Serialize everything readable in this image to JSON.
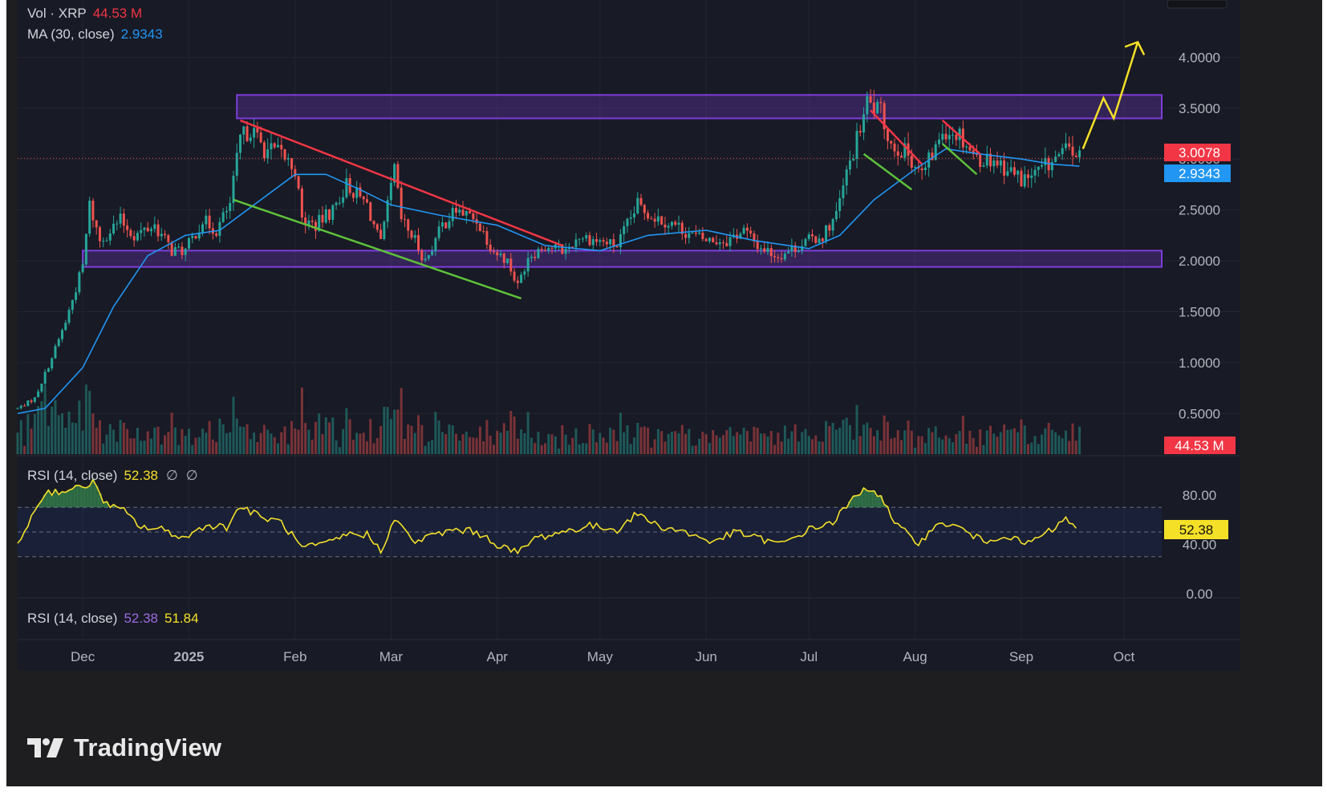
{
  "legend": {
    "vol_label": "Vol · XRP",
    "vol_value": "44.53 M",
    "ma_label": "MA (30, close)",
    "ma_value": "2.9343",
    "rsi_label": "RSI (14, close)",
    "rsi_value": "52.38",
    "rsi_na_1": "∅",
    "rsi_na_2": "∅",
    "rsi2_label": "RSI (14, close)",
    "rsi2_value_a": "52.38",
    "rsi2_value_b": "51.84"
  },
  "badges": {
    "price": "3.0078",
    "ma": "2.9343",
    "volume": "44.53 M",
    "rsi": "52.38"
  },
  "colors": {
    "background": "#1e1e20",
    "pane": "#181a25",
    "up": "#26a69a",
    "down": "#ef5350",
    "ma": "#2196f3",
    "rsi": "#f5e028",
    "zone": "#7e3ddb",
    "resistance_line": "#f23645",
    "support_line": "#5ec23a",
    "arrow": "#f5e028",
    "text": "#b2b5be"
  },
  "brand": {
    "name": "TradingView"
  },
  "chart_data": {
    "type": "candlestick",
    "symbol": "XRP",
    "x_axis": {
      "labels": [
        "Dec",
        "2025",
        "Feb",
        "Mar",
        "Apr",
        "May",
        "Jun",
        "Jul",
        "Aug",
        "Sep",
        "Oct"
      ],
      "dates": [
        "2024-12-01",
        "2025-01-01",
        "2025-02-01",
        "2025-03-01",
        "2025-04-01",
        "2025-05-01",
        "2025-06-01",
        "2025-07-01",
        "2025-08-01",
        "2025-09-01",
        "2025-10-01"
      ],
      "range": [
        "2024-11-12",
        "2025-10-12"
      ]
    },
    "y_axis": {
      "ticks": [
        "4.0000",
        "3.5000",
        "3.0000",
        "2.5000",
        "2.0000",
        "1.5000",
        "1.0000",
        "0.5000"
      ],
      "range": [
        0.1,
        4.5
      ],
      "scale": "linear",
      "position": "right"
    },
    "current_price": 3.0078,
    "ma30_current": 2.9343,
    "volume_current": "44.53 M",
    "price_path": [
      [
        "2024-11-12",
        0.55
      ],
      [
        "2024-11-17",
        0.65
      ],
      [
        "2024-11-22",
        1.05
      ],
      [
        "2024-11-26",
        1.4
      ],
      [
        "2024-12-01",
        1.95
      ],
      [
        "2024-12-03",
        2.55
      ],
      [
        "2024-12-06",
        2.2
      ],
      [
        "2024-12-12",
        2.4
      ],
      [
        "2024-12-16",
        2.25
      ],
      [
        "2024-12-22",
        2.35
      ],
      [
        "2024-12-27",
        2.1
      ],
      [
        "2024-12-31",
        2.1
      ],
      [
        "2025-01-05",
        2.4
      ],
      [
        "2025-01-09",
        2.3
      ],
      [
        "2025-01-13",
        2.55
      ],
      [
        "2025-01-16",
        3.2
      ],
      [
        "2025-01-19",
        3.3
      ],
      [
        "2025-01-23",
        3.1
      ],
      [
        "2025-01-28",
        3.05
      ],
      [
        "2025-02-01",
        2.9
      ],
      [
        "2025-02-03",
        2.4
      ],
      [
        "2025-02-07",
        2.35
      ],
      [
        "2025-02-12",
        2.5
      ],
      [
        "2025-02-16",
        2.75
      ],
      [
        "2025-02-22",
        2.55
      ],
      [
        "2025-02-26",
        2.15
      ],
      [
        "2025-03-02",
        2.9
      ],
      [
        "2025-03-04",
        2.4
      ],
      [
        "2025-03-08",
        2.2
      ],
      [
        "2025-03-11",
        2.0
      ],
      [
        "2025-03-16",
        2.35
      ],
      [
        "2025-03-20",
        2.5
      ],
      [
        "2025-03-26",
        2.4
      ],
      [
        "2025-03-31",
        2.1
      ],
      [
        "2025-04-04",
        2.0
      ],
      [
        "2025-04-07",
        1.75
      ],
      [
        "2025-04-10",
        2.05
      ],
      [
        "2025-04-15",
        2.15
      ],
      [
        "2025-04-21",
        2.1
      ],
      [
        "2025-04-25",
        2.25
      ],
      [
        "2025-04-30",
        2.2
      ],
      [
        "2025-05-06",
        2.15
      ],
      [
        "2025-05-12",
        2.55
      ],
      [
        "2025-05-16",
        2.45
      ],
      [
        "2025-05-23",
        2.35
      ],
      [
        "2025-05-28",
        2.25
      ],
      [
        "2025-06-01",
        2.2
      ],
      [
        "2025-06-07",
        2.2
      ],
      [
        "2025-06-12",
        2.3
      ],
      [
        "2025-06-16",
        2.15
      ],
      [
        "2025-06-22",
        2.05
      ],
      [
        "2025-06-25",
        2.1
      ],
      [
        "2025-07-01",
        2.2
      ],
      [
        "2025-07-05",
        2.25
      ],
      [
        "2025-07-09",
        2.45
      ],
      [
        "2025-07-12",
        2.85
      ],
      [
        "2025-07-16",
        3.3
      ],
      [
        "2025-07-18",
        3.55
      ],
      [
        "2025-07-22",
        3.45
      ],
      [
        "2025-07-25",
        3.15
      ],
      [
        "2025-07-30",
        3.05
      ],
      [
        "2025-08-03",
        2.85
      ],
      [
        "2025-08-07",
        3.1
      ],
      [
        "2025-08-09",
        3.3
      ],
      [
        "2025-08-14",
        3.25
      ],
      [
        "2025-08-19",
        3.0
      ],
      [
        "2025-08-24",
        3.0
      ],
      [
        "2025-08-28",
        2.9
      ],
      [
        "2025-09-01",
        2.8
      ],
      [
        "2025-09-05",
        2.85
      ],
      [
        "2025-09-09",
        2.95
      ],
      [
        "2025-09-13",
        3.05
      ],
      [
        "2025-09-15",
        3.1
      ],
      [
        "2025-09-18",
        3.01
      ]
    ],
    "ma30_path": [
      [
        "2024-11-12",
        0.5
      ],
      [
        "2024-11-20",
        0.55
      ],
      [
        "2024-12-01",
        0.95
      ],
      [
        "2024-12-10",
        1.55
      ],
      [
        "2024-12-20",
        2.05
      ],
      [
        "2024-12-31",
        2.25
      ],
      [
        "2025-01-10",
        2.3
      ],
      [
        "2025-01-20",
        2.55
      ],
      [
        "2025-02-01",
        2.85
      ],
      [
        "2025-02-10",
        2.85
      ],
      [
        "2025-02-20",
        2.7
      ],
      [
        "2025-03-01",
        2.55
      ],
      [
        "2025-03-15",
        2.45
      ],
      [
        "2025-04-01",
        2.35
      ],
      [
        "2025-04-15",
        2.15
      ],
      [
        "2025-05-01",
        2.1
      ],
      [
        "2025-05-15",
        2.25
      ],
      [
        "2025-06-01",
        2.3
      ],
      [
        "2025-06-15",
        2.2
      ],
      [
        "2025-07-01",
        2.12
      ],
      [
        "2025-07-10",
        2.25
      ],
      [
        "2025-07-20",
        2.6
      ],
      [
        "2025-08-01",
        2.9
      ],
      [
        "2025-08-10",
        3.1
      ],
      [
        "2025-08-20",
        3.05
      ],
      [
        "2025-09-01",
        3.0
      ],
      [
        "2025-09-10",
        2.95
      ],
      [
        "2025-09-18",
        2.93
      ]
    ],
    "zones": [
      {
        "from": "2025-01-15",
        "to": "2025-10-12",
        "low": 3.4,
        "high": 3.63
      },
      {
        "from": "2024-12-01",
        "to": "2025-10-12",
        "low": 1.94,
        "high": 2.1
      }
    ],
    "trendlines": [
      {
        "kind": "resistance",
        "points": [
          [
            "2025-01-16",
            3.38
          ],
          [
            "2025-04-20",
            2.15
          ]
        ]
      },
      {
        "kind": "support",
        "points": [
          [
            "2025-01-14",
            2.6
          ],
          [
            "2025-04-08",
            1.63
          ]
        ]
      },
      {
        "kind": "resistance",
        "points": [
          [
            "2025-07-19",
            3.48
          ],
          [
            "2025-08-03",
            2.95
          ]
        ]
      },
      {
        "kind": "support",
        "points": [
          [
            "2025-07-17",
            3.05
          ],
          [
            "2025-07-31",
            2.7
          ]
        ]
      },
      {
        "kind": "resistance",
        "points": [
          [
            "2025-08-09",
            3.38
          ],
          [
            "2025-08-20",
            3.05
          ]
        ]
      },
      {
        "kind": "support",
        "points": [
          [
            "2025-08-09",
            3.15
          ],
          [
            "2025-08-19",
            2.85
          ]
        ]
      }
    ],
    "projection": [
      [
        "2025-09-19",
        3.1
      ],
      [
        "2025-09-25",
        3.6
      ],
      [
        "2025-09-28",
        3.4
      ],
      [
        "2025-10-05",
        4.15
      ]
    ],
    "rsi": {
      "period": 14,
      "current": 52.38,
      "ticks": [
        "80.00",
        "40.00",
        "0.00"
      ],
      "range": [
        0,
        100
      ],
      "bands": [
        30,
        70
      ],
      "path": [
        [
          "2024-11-12",
          40
        ],
        [
          "2024-11-16",
          62
        ],
        [
          "2024-11-20",
          82
        ],
        [
          "2024-11-28",
          84
        ],
        [
          "2024-12-04",
          90
        ],
        [
          "2024-12-08",
          72
        ],
        [
          "2024-12-13",
          67
        ],
        [
          "2024-12-18",
          54
        ],
        [
          "2024-12-24",
          52
        ],
        [
          "2024-12-31",
          45
        ],
        [
          "2025-01-06",
          56
        ],
        [
          "2025-01-12",
          54
        ],
        [
          "2025-01-16",
          71
        ],
        [
          "2025-01-22",
          62
        ],
        [
          "2025-01-28",
          58
        ],
        [
          "2025-02-03",
          37
        ],
        [
          "2025-02-10",
          40
        ],
        [
          "2025-02-16",
          48
        ],
        [
          "2025-02-22",
          48
        ],
        [
          "2025-02-26",
          35
        ],
        [
          "2025-03-02",
          60
        ],
        [
          "2025-03-08",
          42
        ],
        [
          "2025-03-14",
          48
        ],
        [
          "2025-03-20",
          52
        ],
        [
          "2025-03-26",
          50
        ],
        [
          "2025-04-01",
          40
        ],
        [
          "2025-04-07",
          33
        ],
        [
          "2025-04-12",
          45
        ],
        [
          "2025-04-20",
          50
        ],
        [
          "2025-04-28",
          55
        ],
        [
          "2025-05-06",
          52
        ],
        [
          "2025-05-12",
          65
        ],
        [
          "2025-05-18",
          55
        ],
        [
          "2025-05-26",
          50
        ],
        [
          "2025-06-02",
          42
        ],
        [
          "2025-06-10",
          50
        ],
        [
          "2025-06-16",
          45
        ],
        [
          "2025-06-23",
          40
        ],
        [
          "2025-07-01",
          52
        ],
        [
          "2025-07-08",
          58
        ],
        [
          "2025-07-13",
          74
        ],
        [
          "2025-07-18",
          86
        ],
        [
          "2025-07-22",
          80
        ],
        [
          "2025-07-26",
          56
        ],
        [
          "2025-08-02",
          42
        ],
        [
          "2025-08-09",
          58
        ],
        [
          "2025-08-15",
          52
        ],
        [
          "2025-08-21",
          42
        ],
        [
          "2025-08-27",
          48
        ],
        [
          "2025-09-02",
          40
        ],
        [
          "2025-09-08",
          48
        ],
        [
          "2025-09-14",
          60
        ],
        [
          "2025-09-18",
          52
        ]
      ]
    }
  }
}
